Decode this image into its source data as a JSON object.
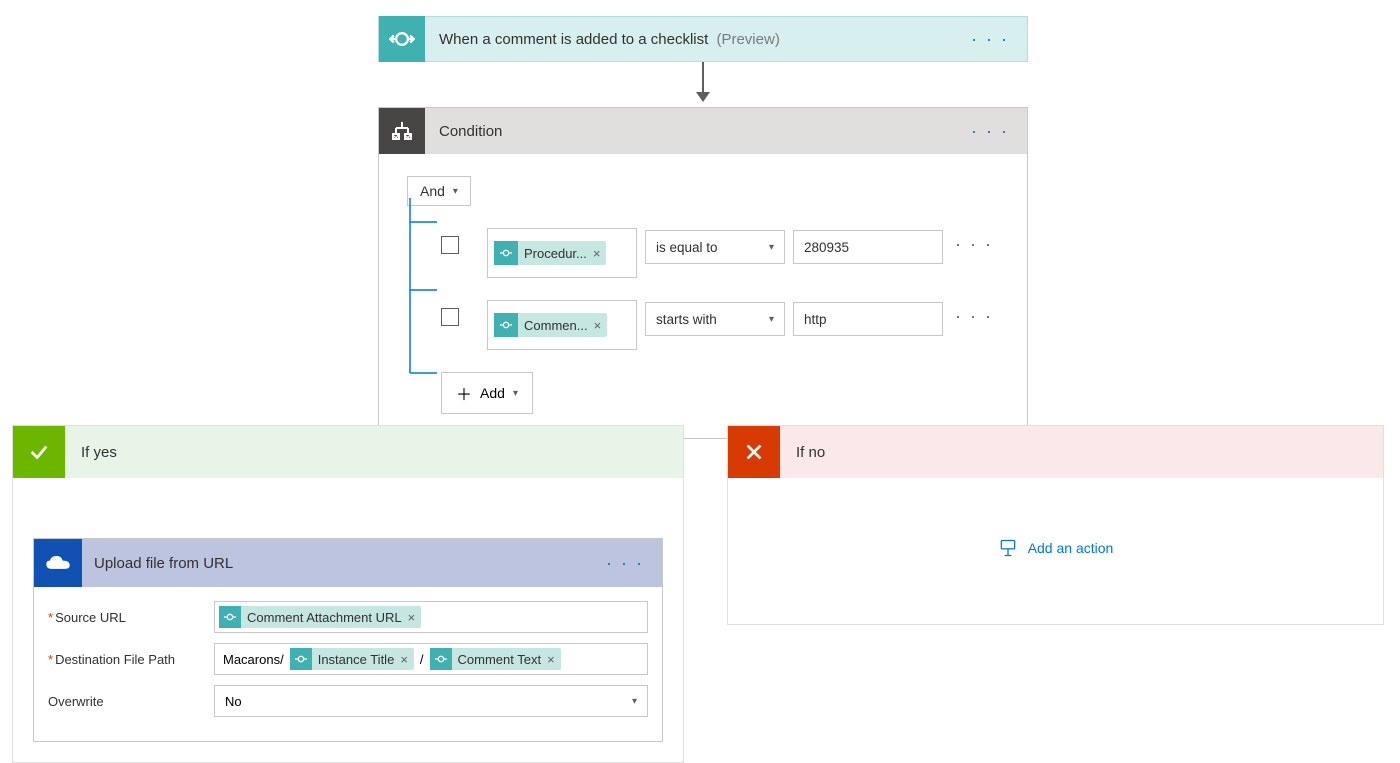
{
  "trigger": {
    "title": "When a comment is added to a checklist",
    "preview": "(Preview)"
  },
  "condition": {
    "title": "Condition",
    "group_operator": "And",
    "add_label": "Add",
    "rules": [
      {
        "field_token": "Procedur...",
        "operator": "is equal to",
        "value": "280935"
      },
      {
        "field_token": "Commen...",
        "operator": "starts with",
        "value": "http"
      }
    ]
  },
  "branches": {
    "yes": {
      "title": "If yes",
      "action": {
        "title": "Upload file from URL",
        "params": {
          "source_url": {
            "label": "Source URL",
            "required": true,
            "tokens": [
              "Comment Attachment URL"
            ]
          },
          "dest_path": {
            "label": "Destination File Path",
            "required": true,
            "prefix": "Macarons/",
            "tokens": [
              "Instance Title",
              "Comment Text"
            ],
            "separator": "/"
          },
          "overwrite": {
            "label": "Overwrite",
            "required": false,
            "value": "No"
          }
        }
      }
    },
    "no": {
      "title": "If no",
      "add_action_label": "Add an action"
    }
  }
}
